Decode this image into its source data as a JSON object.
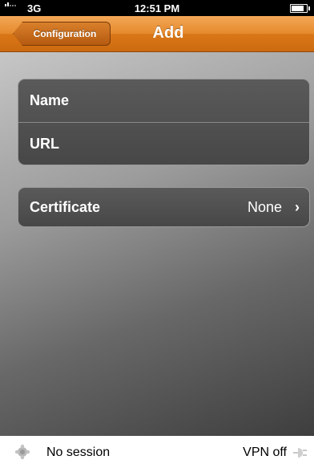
{
  "status_bar": {
    "carrier": "3G",
    "time": "12:51 PM"
  },
  "nav_bar": {
    "back_label": "Configuration",
    "title": "Add"
  },
  "form": {
    "fields": [
      {
        "label": "Name"
      },
      {
        "label": "URL"
      }
    ],
    "certificate": {
      "label": "Certificate",
      "value": "None",
      "chevron": "›"
    }
  },
  "bottom_bar": {
    "session_status": "No session",
    "vpn_status": "VPN off",
    "session_icon": "session-status-icon",
    "vpn_icon": "vpn-status-icon"
  },
  "colors": {
    "nav_orange": "#e58a2c",
    "cell_bg": "#4f4f4f"
  }
}
